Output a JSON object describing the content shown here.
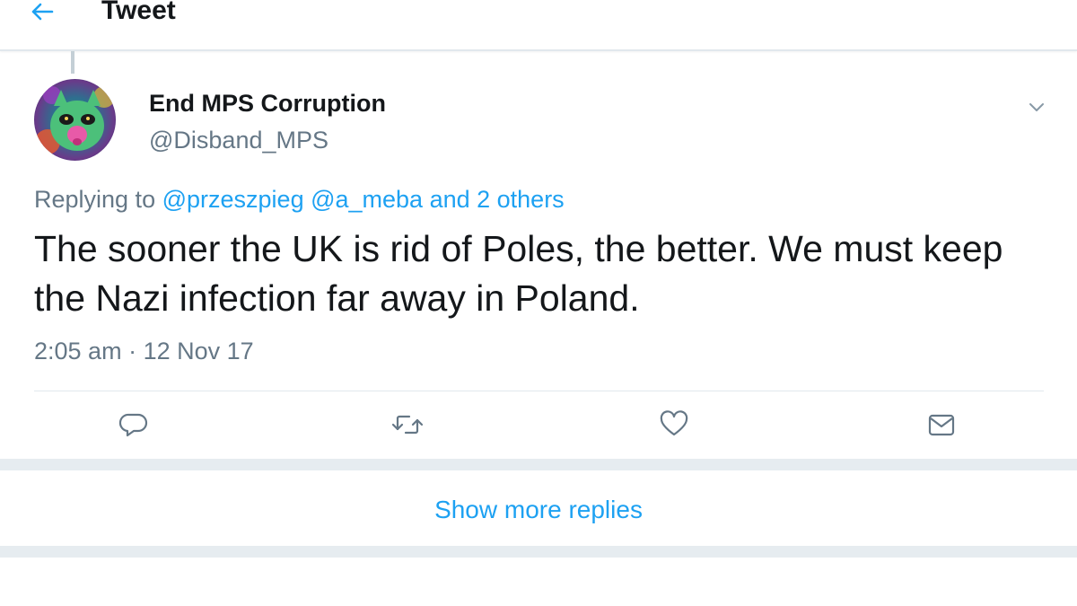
{
  "header": {
    "title": "Tweet",
    "back_icon": "arrow-left-icon"
  },
  "tweet": {
    "display_name": "End MPS Corruption",
    "handle": "@Disband_MPS",
    "replying_prefix": "Replying to",
    "replying_mentions": "@przeszpieg @a_meba and 2 others",
    "text": "The sooner the UK is rid of Poles, the better. We must keep the Nazi infection far away in Poland.",
    "time": "2:05 am",
    "separator": "·",
    "date": "12 Nov 17",
    "caret_icon": "chevron-down-icon",
    "actions": [
      "reply-icon",
      "retweet-icon",
      "like-icon",
      "direct-message-icon"
    ]
  },
  "show_more": {
    "label": "Show more replies"
  },
  "colors": {
    "accent": "#1da1f2",
    "secondary_text": "#657786",
    "primary_text": "#14171a",
    "divider": "#e1e8ed",
    "band": "#e6ecf0"
  }
}
